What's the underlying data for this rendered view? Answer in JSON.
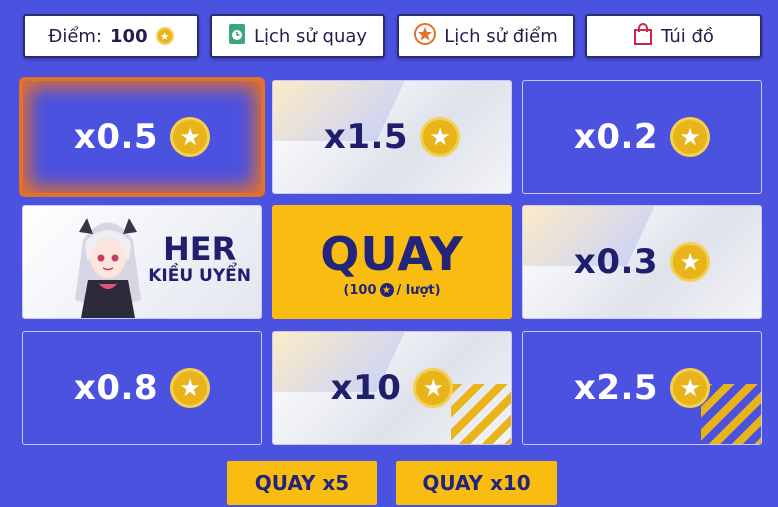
{
  "topbar": {
    "points_label": "Điểm:",
    "points_value": "100",
    "history_spin_label": "Lịch sử quay",
    "history_points_label": "Lịch sử điểm",
    "bag_label": "Túi đồ"
  },
  "grid": {
    "cells": [
      {
        "label": "x0.5",
        "style": "blue"
      },
      {
        "label": "x1.5",
        "style": "light"
      },
      {
        "label": "x0.2",
        "style": "blue"
      },
      {
        "label": "HER",
        "sub": "KIỀU UYỂN",
        "style": "character"
      },
      {
        "label": "QUAY",
        "sub": "(100",
        "sub2": "/ lượt)",
        "style": "spin"
      },
      {
        "label": "x0.3",
        "style": "light"
      },
      {
        "label": "x0.8",
        "style": "blue"
      },
      {
        "label": "x10",
        "style": "light"
      },
      {
        "label": "x2.5",
        "style": "blue"
      }
    ],
    "highlighted_index": 0
  },
  "actions": {
    "spin5_label": "QUAY x5",
    "spin10_label": "QUAY x10"
  },
  "colors": {
    "background": "#4b52e0",
    "accent": "#f9bd12",
    "coin": "#e9b41a",
    "text_dark": "#23257a",
    "highlight": "#e3712a"
  },
  "icons": {
    "points": "star-coin-icon",
    "history_spin": "clock-book-icon",
    "history_points": "star-circle-icon",
    "bag": "shopping-bag-icon"
  }
}
